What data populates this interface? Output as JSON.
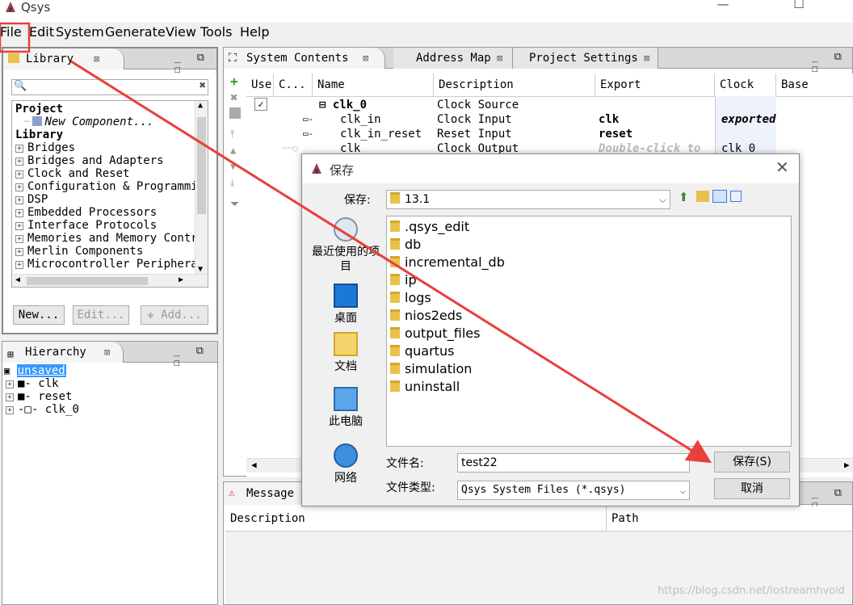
{
  "window": {
    "title": "Qsys",
    "min": "—",
    "max": "☐",
    "close": "✕"
  },
  "menu": [
    "File",
    "Edit",
    "System",
    "Generate",
    "View",
    "Tools",
    "Help"
  ],
  "library": {
    "tab": "Library",
    "search_placeholder": "",
    "project_header": "Project",
    "new_component": "New Component...",
    "library_header": "Library",
    "items": [
      "Bridges",
      "Bridges and Adapters",
      "Clock and Reset",
      "Configuration & Programmi",
      "DSP",
      "Embedded Processors",
      "Interface Protocols",
      "Memories and Memory Contr",
      "Merlin Components",
      "Microcontroller Periphera"
    ],
    "buttons": {
      "new": "New...",
      "edit": "Edit...",
      "add": "Add..."
    }
  },
  "hierarchy": {
    "tab": "Hierarchy",
    "root": "unsaved",
    "items": [
      "clk",
      "reset",
      "clk_0"
    ]
  },
  "main_tabs": [
    "System Contents",
    "Address Map",
    "Project Settings"
  ],
  "contents_table": {
    "columns": [
      "Use",
      "C...",
      "Name",
      "Description",
      "Export",
      "Clock",
      "Base"
    ],
    "rows": [
      {
        "name": "clk_0",
        "description": "Clock Source",
        "export": "",
        "clock": ""
      },
      {
        "name": "clk_in",
        "description": "Clock Input",
        "export": "clk",
        "clock": "exported"
      },
      {
        "name": "clk_in_reset",
        "description": "Reset Input",
        "export": "reset",
        "clock": ""
      },
      {
        "name": "clk",
        "description": "Clock Output",
        "export": "Double-click to",
        "clock": "clk_0"
      }
    ]
  },
  "messages": {
    "tab": "Message",
    "columns": [
      "Description",
      "Path"
    ]
  },
  "dialog": {
    "title": "保存",
    "save_in_label": "保存:",
    "current_folder": "13.1",
    "places": [
      "最近使用的项目",
      "桌面",
      "文档",
      "此电脑",
      "网络"
    ],
    "folders": [
      ".qsys_edit",
      "db",
      "incremental_db",
      "ip",
      "logs",
      "nios2eds",
      "output_files",
      "quartus",
      "simulation",
      "uninstall"
    ],
    "filename_label": "文件名:",
    "filename_value": "test22",
    "filetype_label": "文件类型:",
    "filetype_value": "Qsys System Files (*.qsys)",
    "save_button": "保存(S)",
    "cancel_button": "取消"
  },
  "annotation_color": "#e8403a",
  "watermark": "https://blog.csdn.net/lostreamhvoid"
}
